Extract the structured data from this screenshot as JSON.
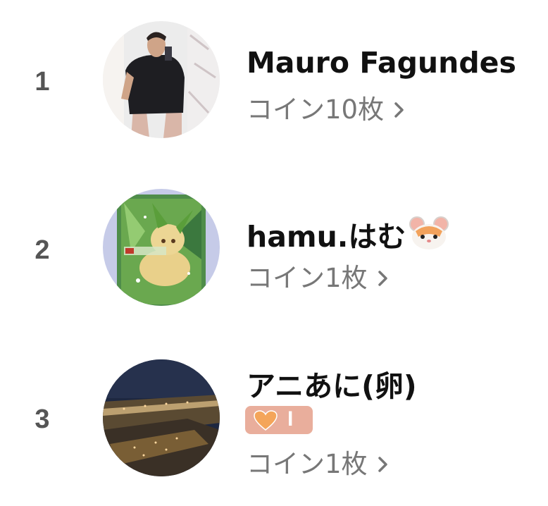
{
  "ranking": [
    {
      "rank": "1",
      "name": "Mauro Fagundes",
      "coins": "コイン10枚",
      "avatar": "person-mirror-selfie"
    },
    {
      "rank": "2",
      "name": "hamu.はむ",
      "name_emoji": "hamster-face-icon",
      "coins": "コイン1枚",
      "avatar": "leafeon-card"
    },
    {
      "rank": "3",
      "name": "アニあに(卵)",
      "badge": {
        "icon": "orange-heart-icon",
        "level": "I",
        "color": "#e9ae9c"
      },
      "coins": "コイン1枚",
      "avatar": "night-city-lights"
    }
  ],
  "colors": {
    "name": "#111111",
    "rank": "#555555",
    "coins": "#777777",
    "badge": "#e9ae9c"
  }
}
